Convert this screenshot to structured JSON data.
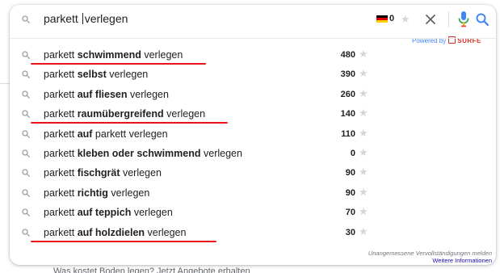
{
  "search": {
    "value_before_caret": "parkett ",
    "value_after_caret": "verlegen",
    "search_icon": "search-icon"
  },
  "toolbar": {
    "flag_icon": "german-flag-icon",
    "count": "0",
    "star_icon": "star-icon",
    "clear_icon": "close-icon",
    "mic_icon": "microphone-icon",
    "submit_icon": "search-icon"
  },
  "powered_by": {
    "prefix": "Powered by",
    "brand": "SURFE"
  },
  "suggestions": [
    {
      "pre": "parkett ",
      "bold": "schwimmend",
      "post": " verlegen",
      "volume": "480",
      "highlighted": true
    },
    {
      "pre": "parkett ",
      "bold": "selbst",
      "post": " verlegen",
      "volume": "390",
      "highlighted": false
    },
    {
      "pre": "parkett ",
      "bold": "auf fliesen",
      "post": " verlegen",
      "volume": "260",
      "highlighted": false
    },
    {
      "pre": "parkett ",
      "bold": "raumübergreifend",
      "post": " verlegen",
      "volume": "140",
      "highlighted": true
    },
    {
      "pre": "parkett ",
      "bold": "auf",
      "post": " parkett verlegen",
      "volume": "110",
      "highlighted": false
    },
    {
      "pre": "parkett ",
      "bold": "kleben oder schwimmend",
      "post": " verlegen",
      "volume": "0",
      "highlighted": false
    },
    {
      "pre": "parkett ",
      "bold": "fischgrät",
      "post": " verlegen",
      "volume": "90",
      "highlighted": false
    },
    {
      "pre": "parkett ",
      "bold": "richtig",
      "post": " verlegen",
      "volume": "90",
      "highlighted": false
    },
    {
      "pre": "parkett ",
      "bold": "auf teppich",
      "post": " verlegen",
      "volume": "70",
      "highlighted": false
    },
    {
      "pre": "parkett ",
      "bold": "auf holzdielen",
      "post": " verlegen",
      "volume": "30",
      "highlighted": true
    }
  ],
  "footer": {
    "report": "Unangemessene Vervollständigungen melden",
    "info": "Weitere Informationen"
  },
  "below_text": "Was kostet Boden legen? Jetzt Angebote erhalten",
  "colors": {
    "highlight_underline": "#e8131c",
    "text": "#202124",
    "icon_gray": "#9aa0a6",
    "link_blue": "#1a0dab",
    "google_blue": "#4285f4",
    "star_gray": "#d3d6da"
  }
}
